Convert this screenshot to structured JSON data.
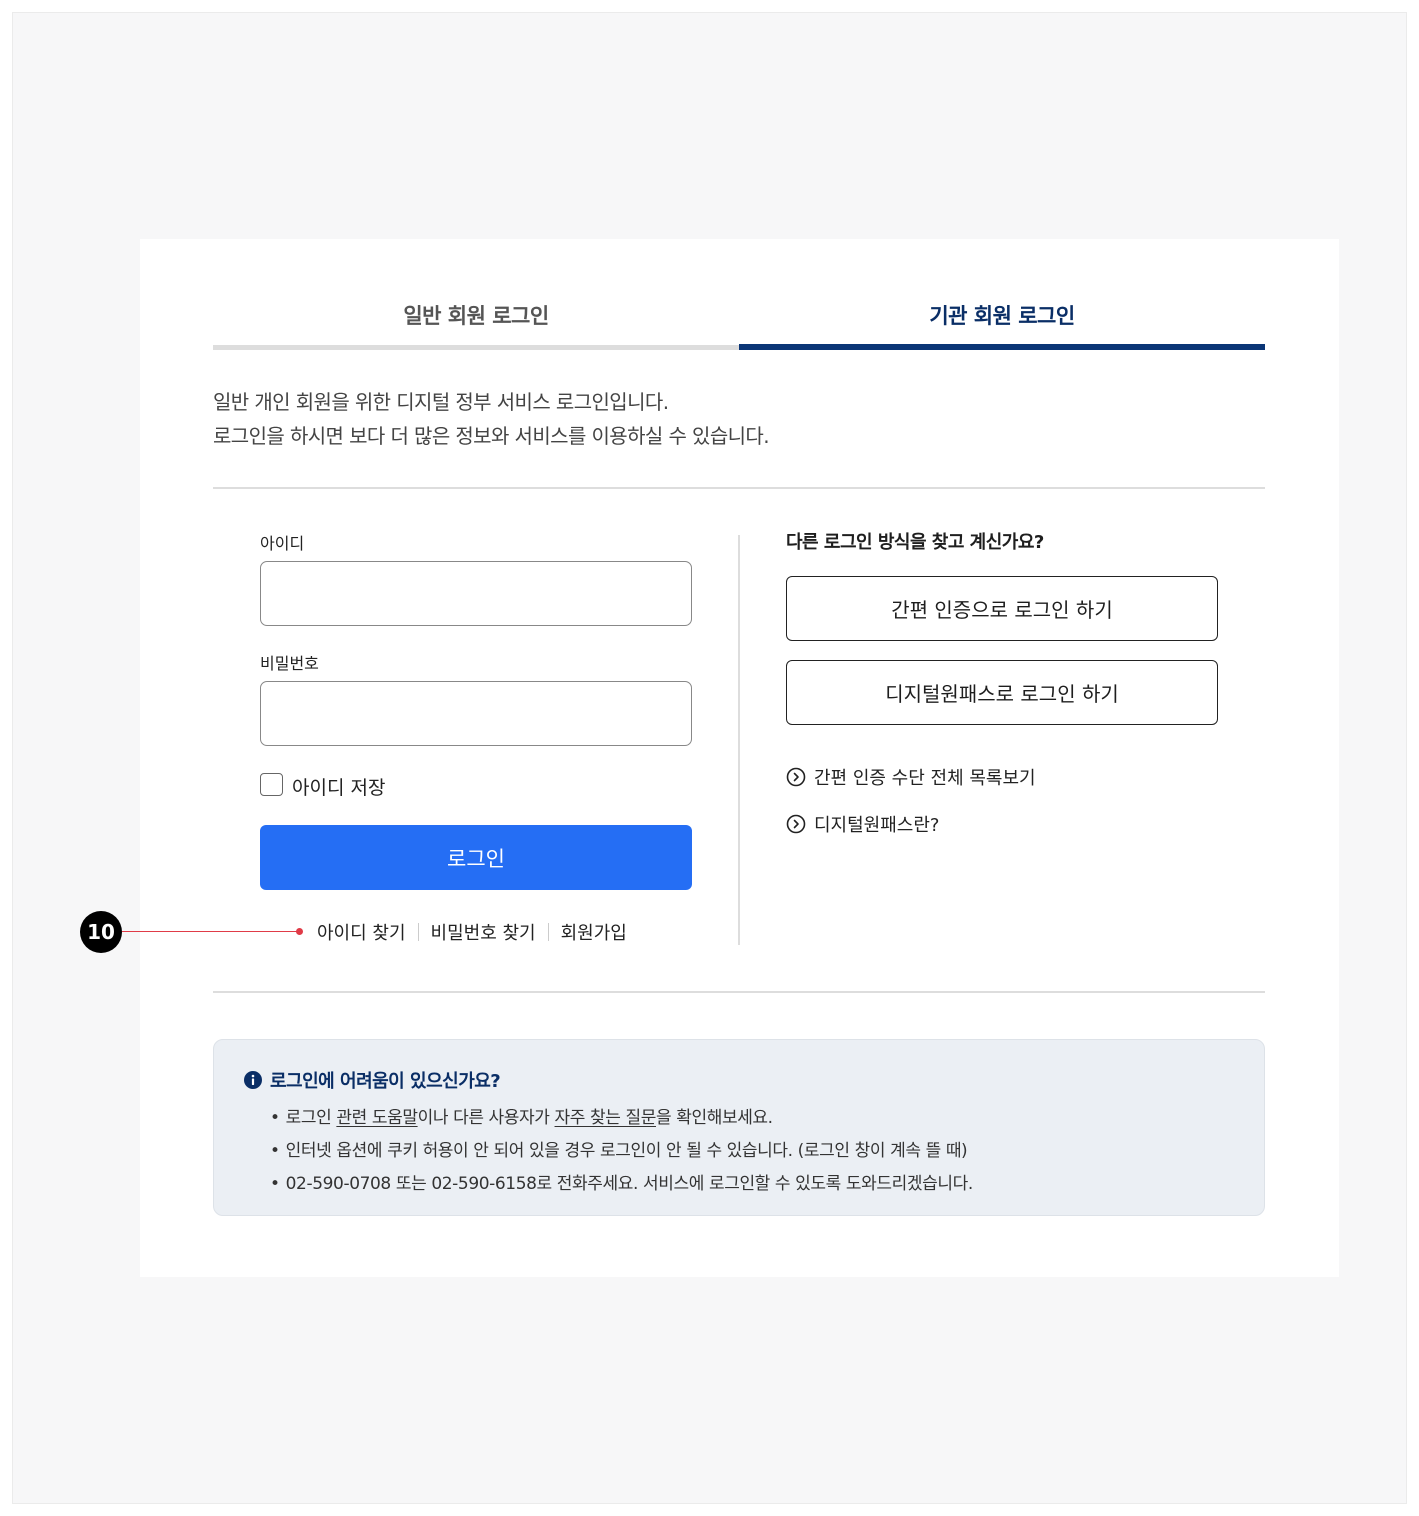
{
  "tabs": [
    {
      "label": "일반 회원 로그인",
      "active": false
    },
    {
      "label": "기관 회원 로그인",
      "active": true
    }
  ],
  "intro": {
    "line1": "일반 개인 회원을 위한 디지털 정부 서비스 로그인입니다.",
    "line2": "로그인을 하시면 보다 더 많은 정보와 서비스를 이용하실 수 있습니다."
  },
  "form": {
    "id_label": "아이디",
    "id_value": "",
    "password_label": "비밀번호",
    "password_value": "",
    "save_id_label": "아이디 저장",
    "save_id_checked": false,
    "login_button": "로그인"
  },
  "links": {
    "find_id": "아이디 찾기",
    "find_password": "비밀번호 찾기",
    "signup": "회원가입"
  },
  "alt_login": {
    "title": "다른 로그인 방식을 찾고 계신가요?",
    "simple_auth_button": "간편 인증으로 로그인 하기",
    "digital_onepass_button": "디지털원패스로 로그인 하기",
    "simple_auth_list_link": "간편 인증 수단 전체 목록보기",
    "digital_onepass_info_link": "디지털원패스란?"
  },
  "help": {
    "title": "로그인에 어려움이 있으신가요?",
    "item1": {
      "prefix": "로그인 ",
      "link1": "관련 도움말",
      "middle": "이나 다른 사용자가 ",
      "link2": "자주 찾는 질문",
      "suffix": "을 확인해보세요."
    },
    "item2": "인터넷 옵션에 쿠키 허용이 안 되어 있을 경우 로그인이 안 될 수 있습니다. (로그인 창이 계속 뜰 때)",
    "item3": "02-590-0708 또는 02-590-6158로 전화주세요. 서비스에 로그인할 수 있도록 도와드리겠습니다."
  },
  "annotation": {
    "marker_number": "10"
  },
  "colors": {
    "primary_blue": "#256ef4",
    "navy": "#0b3576",
    "help_bg": "#ebeff4",
    "annotation_red": "#e03b47"
  }
}
